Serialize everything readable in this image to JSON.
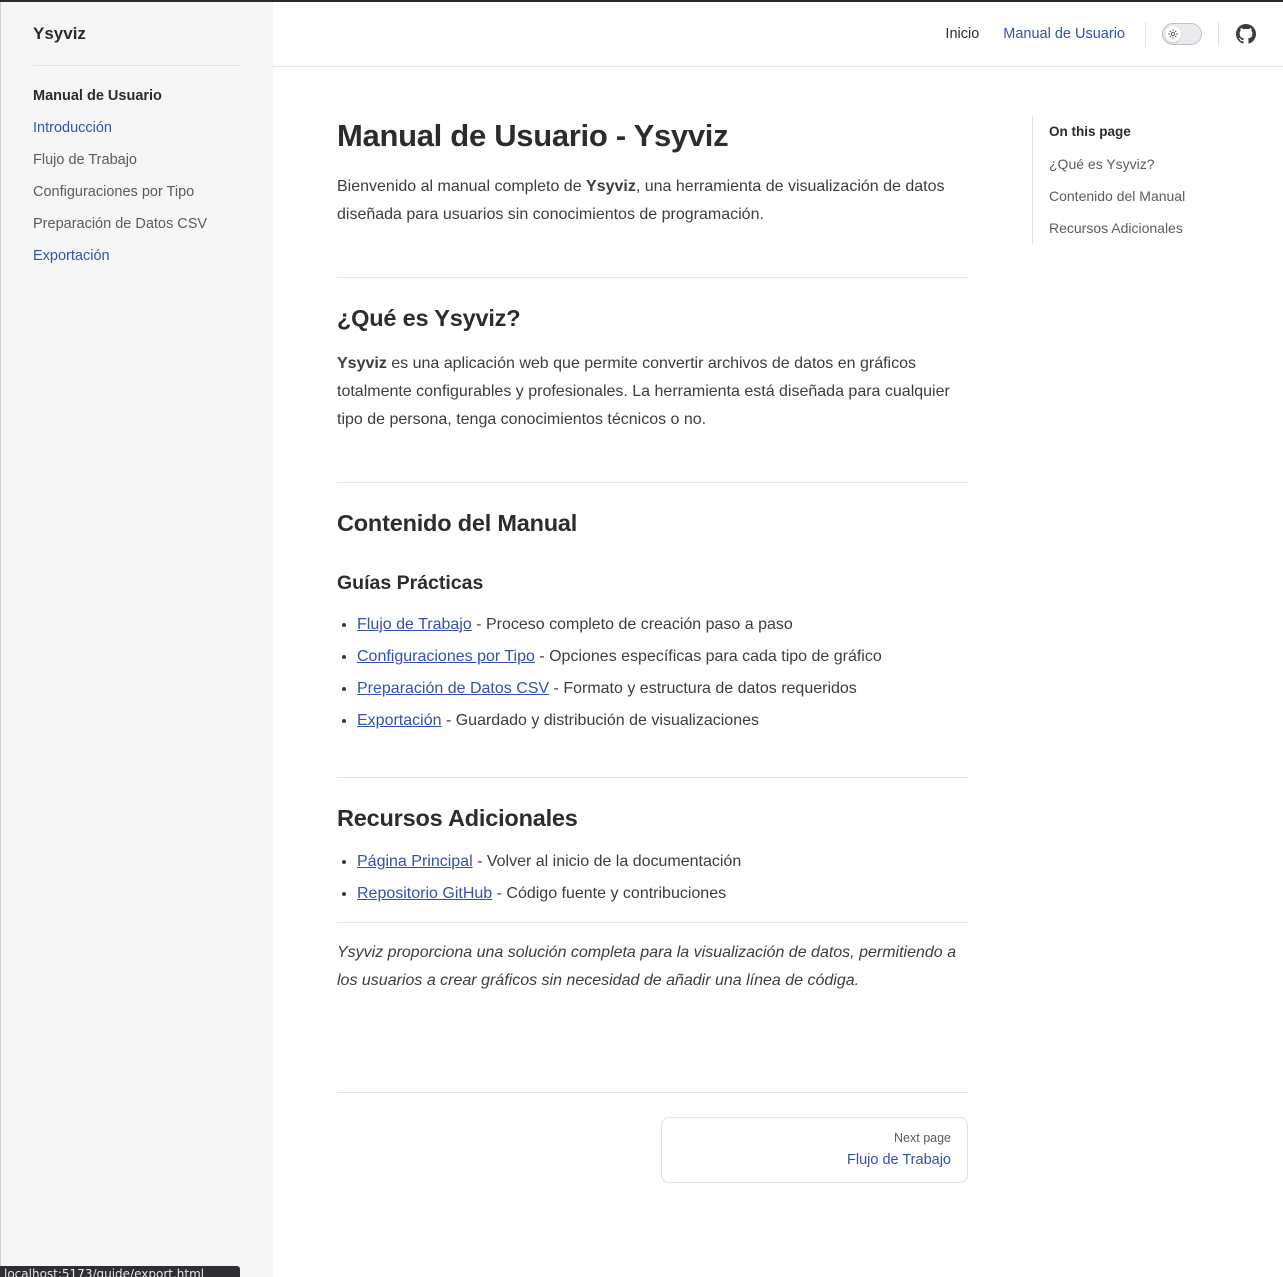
{
  "brand": "Ysyviz",
  "sidebar": {
    "group_title": "Manual de Usuario",
    "items": [
      {
        "label": "Introducción"
      },
      {
        "label": "Flujo de Trabajo"
      },
      {
        "label": "Configuraciones por Tipo"
      },
      {
        "label": "Preparación de Datos CSV"
      },
      {
        "label": "Exportación"
      }
    ]
  },
  "nav": {
    "home": "Inicio",
    "manual": "Manual de Usuario"
  },
  "main": {
    "title": "Manual de Usuario - Ysyviz",
    "intro_before": "Bienvenido al manual completo de ",
    "intro_bold": "Ysyviz",
    "intro_after": ", una herramienta de visualización de datos diseñada para usuarios sin conocimientos de programación.",
    "what_heading": "¿Qué es Ysyviz?",
    "what_bold": "Ysyviz",
    "what_text": " es una aplicación web que permite convertir archivos de datos en gráficos totalmente configurables y profesionales. La herramienta está diseñada para cualquier tipo de persona, tenga conocimientos técnicos o no.",
    "contents_heading": "Contenido del Manual",
    "guides_heading": "Guías Prácticas",
    "guides": [
      {
        "link": "Flujo de Trabajo",
        "desc": " - Proceso completo de creación paso a paso"
      },
      {
        "link": "Configuraciones por Tipo",
        "desc": " - Opciones específicas para cada tipo de gráfico"
      },
      {
        "link": "Preparación de Datos CSV",
        "desc": " - Formato y estructura de datos requeridos"
      },
      {
        "link": "Exportación",
        "desc": " - Guardado y distribución de visualizaciones"
      }
    ],
    "resources_heading": "Recursos Adicionales",
    "resources": [
      {
        "link": "Página Principal",
        "desc": " - Volver al inicio de la documentación"
      },
      {
        "link": "Repositorio GitHub",
        "desc": " - Código fuente y contribuciones"
      }
    ],
    "closing": "Ysyviz proporciona una solución completa para la visualización de datos, permitiendo a los usuarios a crear gráficos sin necesidad de añadir una línea de códiga."
  },
  "pager": {
    "label": "Next page",
    "title": "Flujo de Trabajo"
  },
  "outline": {
    "title": "On this page",
    "items": [
      {
        "label": "¿Qué es Ysyviz?"
      },
      {
        "label": "Contenido del Manual"
      },
      {
        "label": "Recursos Adicionales"
      }
    ]
  },
  "status_url": "localhost:5173/guide/export.html",
  "colors": {
    "accent": "#3451b2",
    "sidebar_bg": "#f6f6f7",
    "text": "#3c3c43"
  }
}
